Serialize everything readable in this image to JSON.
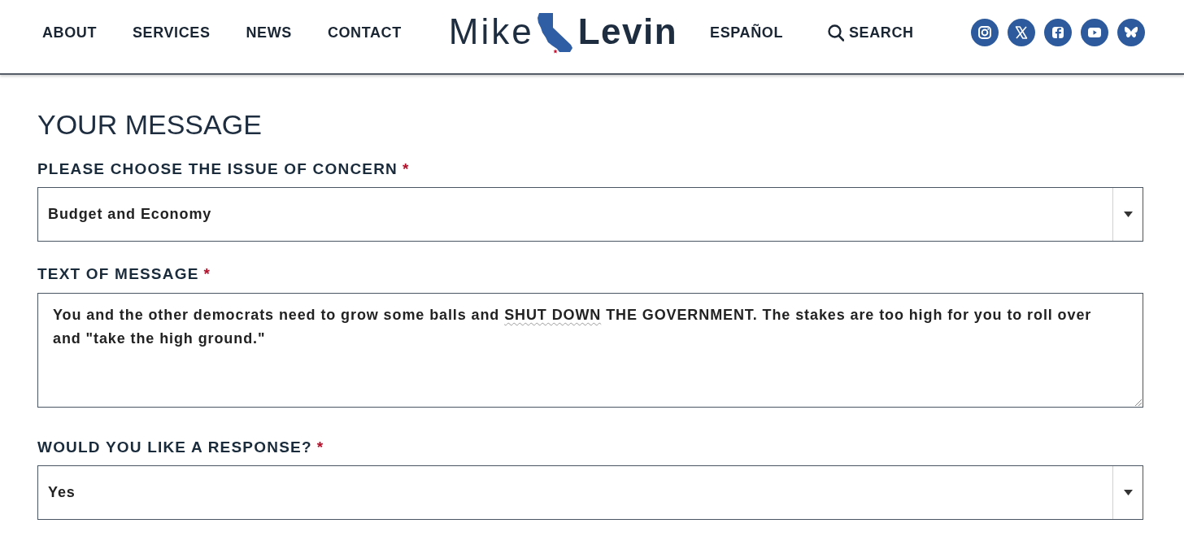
{
  "header": {
    "nav_left": [
      "ABOUT",
      "SERVICES",
      "NEWS",
      "CONTACT"
    ],
    "logo": {
      "first": "Mike",
      "last": "Levin"
    },
    "language": "ESPAÑOL",
    "search": "SEARCH",
    "social_links": [
      {
        "kind": "camera"
      },
      {
        "kind": "x"
      },
      {
        "kind": "f"
      },
      {
        "kind": "play"
      },
      {
        "kind": "butterfly"
      }
    ]
  },
  "form": {
    "heading": "YOUR MESSAGE",
    "fields": [
      {
        "kind": "select",
        "label": "PLEASE CHOOSE THE ISSUE OF CONCERN",
        "required_mark": "*",
        "value": "Budget and Economy"
      },
      {
        "kind": "textarea",
        "label": "TEXT OF MESSAGE",
        "required_mark": "*",
        "value_parts": [
          {
            "text": "You and the other democrats need to grow some balls and ",
            "misspelled": false
          },
          {
            "text": "SHUT DOWN",
            "misspelled": true
          },
          {
            "text": " THE GOVERNMENT. The stakes are too high for you to roll over and \"take the high ground.\"",
            "misspelled": false
          }
        ]
      },
      {
        "kind": "select",
        "label": "WOULD YOU LIKE A RESPONSE?",
        "required_mark": "*",
        "value": "Yes"
      }
    ]
  }
}
